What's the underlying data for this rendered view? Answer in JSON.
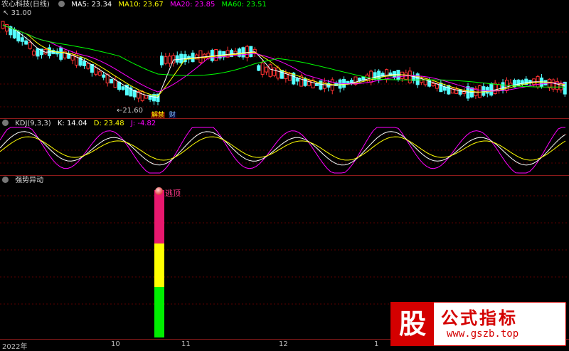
{
  "main": {
    "title": "农心科技(日线)",
    "ma": [
      {
        "label": "MA5: 23.34",
        "color": "#ffffff"
      },
      {
        "label": "MA10: 23.67",
        "color": "#ffff00"
      },
      {
        "label": "MA20: 23.85",
        "color": "#ff00ff"
      },
      {
        "label": "MA60: 23.51",
        "color": "#00ff00"
      }
    ],
    "high_label": "31.00",
    "low_label": "21.60",
    "markers": [
      "解禁",
      "财"
    ]
  },
  "kdj": {
    "title": "KDJ(9,3,3)",
    "k": "K: 14.04",
    "d": "D: 23.48",
    "j": "J: -4.82"
  },
  "signal": {
    "title": "强势异动",
    "label": "逃顶",
    "segments": {
      "green": 0.35,
      "yellow": 0.3,
      "red": 0.35
    }
  },
  "axis": {
    "labels": [
      "2022年",
      "10",
      "11",
      "12",
      "1"
    ]
  },
  "watermark": {
    "badge": "股",
    "title": "公式指标",
    "url": "www.gszb.top"
  },
  "colors": {
    "up": "#ff3232",
    "down": "#54ffff",
    "separator": "#8b1a1a"
  }
}
